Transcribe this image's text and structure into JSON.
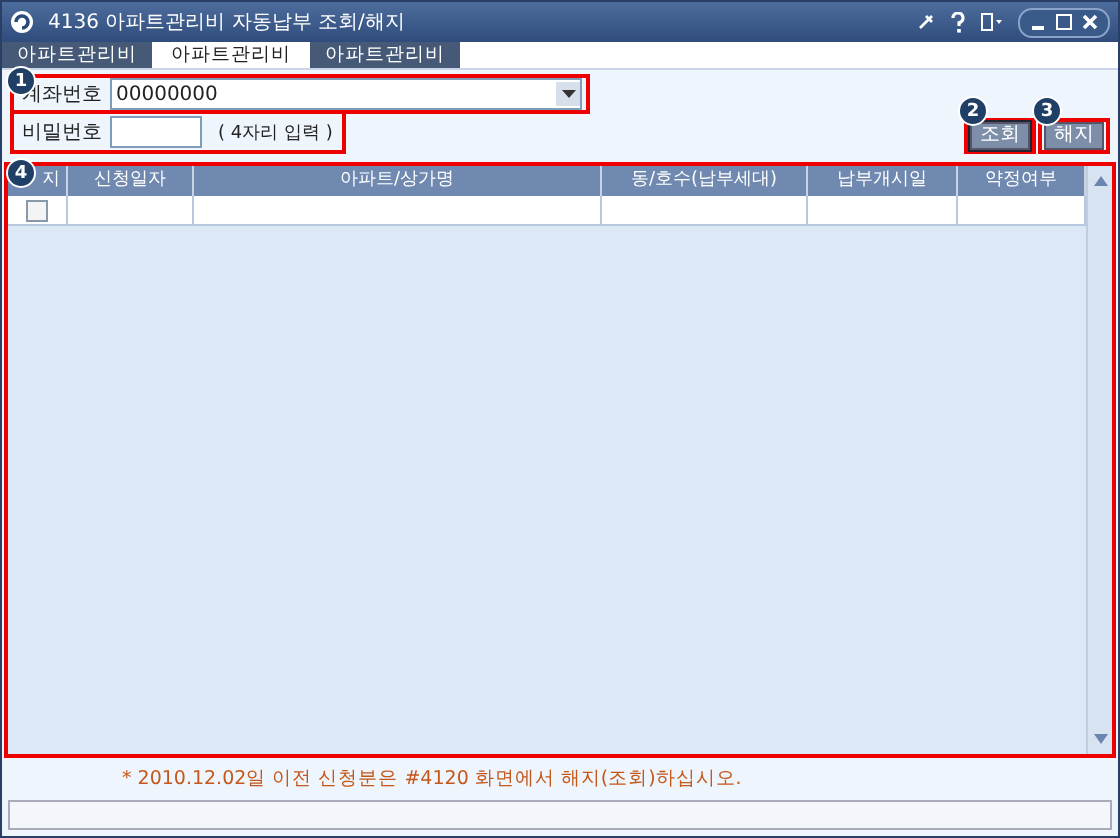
{
  "window": {
    "title": "4136 아파트관리비 자동납부 조회/해지"
  },
  "tabs": [
    {
      "label": "아파트관리비",
      "selected": false
    },
    {
      "label": "아파트관리비",
      "selected": true
    },
    {
      "label": "아파트관리비",
      "selected": false
    }
  ],
  "form": {
    "account_label": "계좌번호",
    "account_value": "00000000",
    "password_label": "비밀번호",
    "password_hint": "( 4자리 입력 )"
  },
  "buttons": [
    {
      "label": "조회",
      "selected": true
    },
    {
      "label": "해지",
      "selected": false
    }
  ],
  "annotations": [
    "1",
    "2",
    "3",
    "4"
  ],
  "table": {
    "columns": [
      "지",
      "신청일자",
      "아파트/상가명",
      "동/호수(납부세대)",
      "납부개시일",
      "약정여부"
    ],
    "rows": [
      {
        "checked": false
      }
    ]
  },
  "note": "* 2010.12.02일 이전 신청분은 #4120 화면에서 해지(조회)하십시오."
}
